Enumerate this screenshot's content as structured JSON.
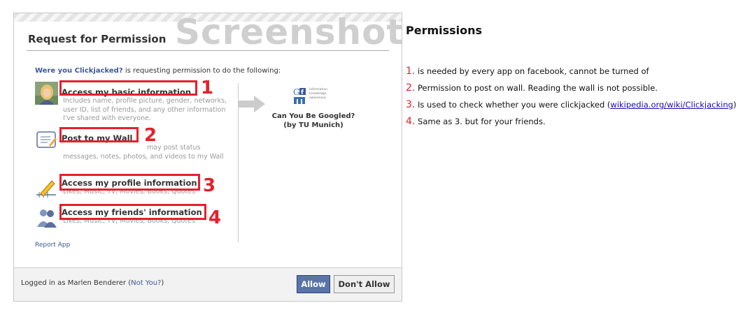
{
  "dialog": {
    "title": "Request for Permission",
    "watermark": "Screenshot",
    "intro_app": "Were you Clickjacked?",
    "intro_text": " is requesting permission to do the following:",
    "permissions": [
      {
        "title": "Access my basic information",
        "desc": "Includes name, profile picture, gender, networks, user ID, list of friends, and any other information I've shared with everyone.",
        "marker": "1",
        "icon": "user-photo-icon"
      },
      {
        "title": "Post to my Wall",
        "desc": "may post status messages, notes, photos, and videos to my Wall",
        "marker": "2",
        "icon": "wall-post-icon"
      },
      {
        "title": "Access my profile information",
        "desc": "Likes, Music, TV, Movies, Books, Quotes",
        "marker": "3",
        "icon": "profile-pencil-icon"
      },
      {
        "title": "Access my friends' information",
        "desc": "Likes, Music, TV, Movies, Books, Quotes",
        "marker": "4",
        "icon": "friends-icon"
      }
    ],
    "app_name": "Can You Be Googled?",
    "app_subtitle": "(by TU Munich)",
    "logo_text": "information. knowledge. awareness.",
    "report_link": "Report App",
    "footer_prefix": "Logged in as Marlen Benderer (",
    "footer_link": "Not You?",
    "footer_suffix": ")",
    "allow_label": "Allow",
    "deny_label": "Don't Allow"
  },
  "side": {
    "title": "Permissions",
    "notes": [
      {
        "n": "1.",
        "text": " is needed by every app on facebook, cannot be turned of"
      },
      {
        "n": "2.",
        "text": " Permission to post on wall. Reading the wall is not possible."
      },
      {
        "n": "3.",
        "text": " Is used to check whether you were clickjacked (",
        "link": "wikipedia.org/wiki/Clickjacking",
        "after": ")"
      },
      {
        "n": "4.",
        "text": " Same as 3. but for your friends."
      }
    ]
  },
  "colors": {
    "marker_red": "#e5202d",
    "facebook_blue": "#3b5998",
    "allow_button": "#5b74a8"
  }
}
